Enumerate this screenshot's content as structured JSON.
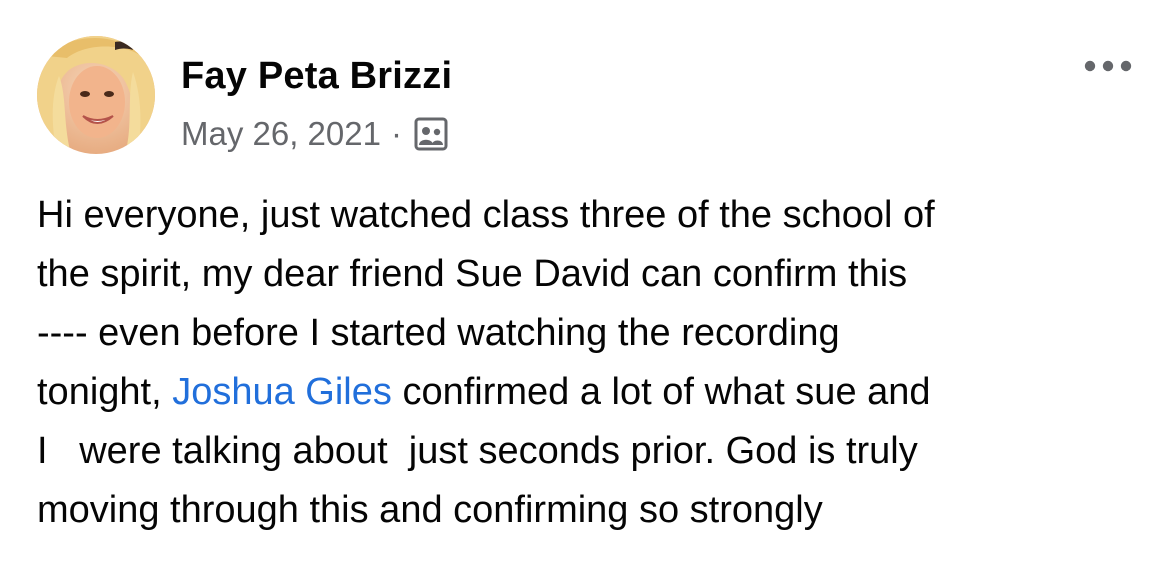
{
  "post": {
    "author": {
      "name": "Fay Peta Brizzi",
      "avatar_icon": "profile-photo"
    },
    "meta": {
      "date": "May 26, 2021",
      "separator": "·",
      "audience_icon": "group-members-icon"
    },
    "more_icon": "more-horizontal-icon",
    "body": {
      "text_1": "Hi everyone, just watched class three of the school of\nthe spirit, my dear friend Sue David can confirm this\n---- even before I started watching the recording\ntonight, ",
      "mention": "Joshua Giles",
      "text_2": " confirmed a lot of what sue and\nI   were talking about  just seconds prior. God is truly\nmoving through this and confirming so strongly"
    }
  },
  "colors": {
    "text_primary": "#050505",
    "text_secondary": "#65676b",
    "mention_link": "#216fdb",
    "background": "#ffffff"
  }
}
